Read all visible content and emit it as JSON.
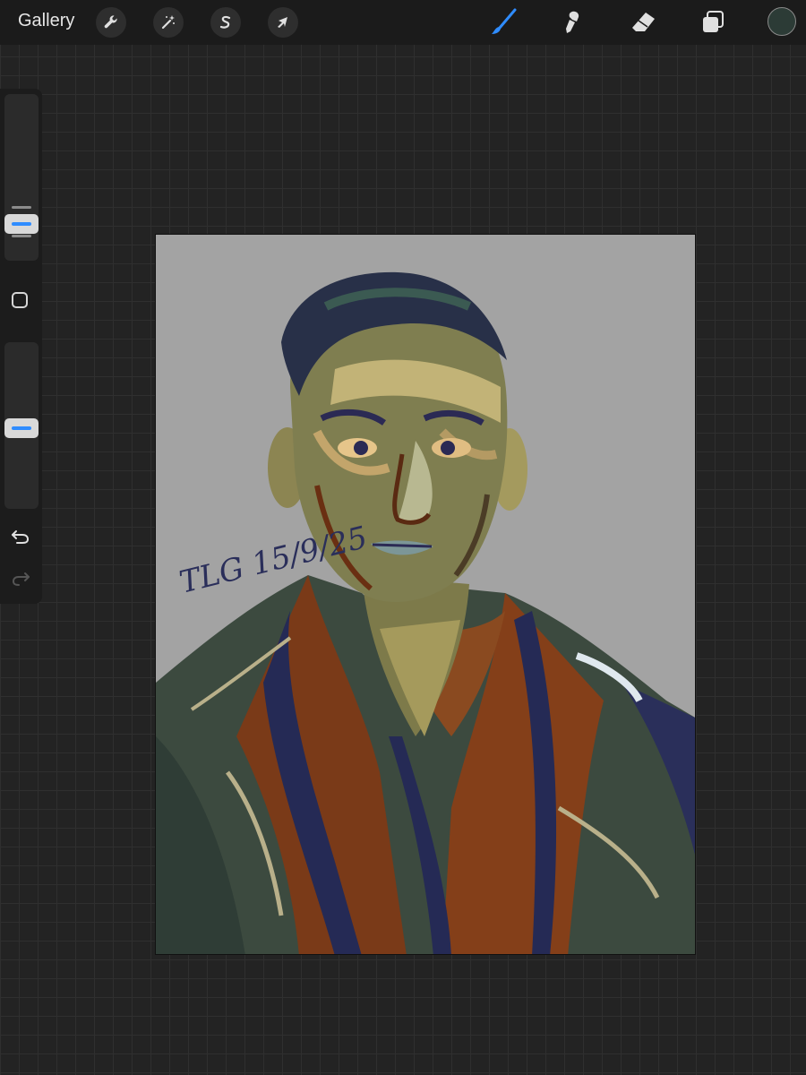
{
  "topbar": {
    "gallery_label": "Gallery",
    "left_tools": [
      {
        "name": "wrench-icon",
        "label": "Actions"
      },
      {
        "name": "magic-wand-icon",
        "label": "Adjustments"
      },
      {
        "name": "selection-icon",
        "label": "Selection"
      },
      {
        "name": "arrow-cursor-icon",
        "label": "Transform"
      }
    ],
    "right_tools": [
      {
        "name": "brush-icon",
        "active": true
      },
      {
        "name": "smudge-icon",
        "active": false
      },
      {
        "name": "eraser-icon",
        "active": false
      },
      {
        "name": "layers-icon",
        "active": false
      }
    ],
    "current_color": "#2c3b36"
  },
  "sidebar": {
    "brush_size_level": 0.25,
    "opacity_level": 0.5,
    "accent_color": "#2f8cff"
  },
  "canvas": {
    "background_color": "#a3a3a3",
    "signature": "TLG 15/9/25"
  }
}
